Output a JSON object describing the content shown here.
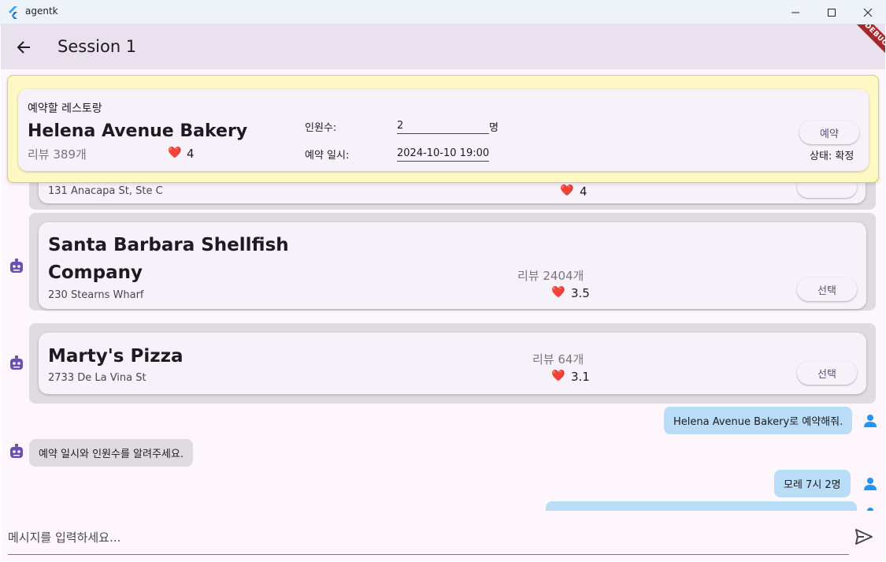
{
  "window": {
    "title": "agentk"
  },
  "appbar": {
    "title": "Session 1",
    "debug_label": "DEBUG"
  },
  "reservation": {
    "header": "예약할 레스토랑",
    "name": "Helena Avenue Bakery",
    "reviews": "리뷰 389개",
    "rating": "4",
    "party_label": "인원수:",
    "party_value": "2",
    "party_unit": "명",
    "datetime_label": "예약 일시:",
    "datetime_value": "2024-10-10 19:00",
    "reserve_button": "예약",
    "status": "상태: 확정"
  },
  "restaurants": [
    {
      "address": "131 Anacapa St, Ste C",
      "rating": "4"
    },
    {
      "name_line1": "Santa Barbara Shellfish",
      "name_line2": "Company",
      "address": "230 Stearns Wharf",
      "reviews": "리뷰 2404개",
      "rating": "3.5",
      "button": "선택"
    },
    {
      "name": "Marty's Pizza",
      "address": "2733 De La Vina St",
      "reviews": "리뷰 64개",
      "rating": "3.1",
      "button": "선택"
    }
  ],
  "messages": [
    {
      "role": "user",
      "text": "Helena Avenue Bakery로 예약해줘."
    },
    {
      "role": "bot",
      "text": "예약 일시와 인원수를 알려주세요."
    },
    {
      "role": "user",
      "text": "모레 7시 2명"
    }
  ],
  "input": {
    "placeholder": "메시지를 입력하세요..."
  },
  "colors": {
    "appbar": "#e9e1ed",
    "panel": "#fff8c5",
    "user_bubble": "#b9dcf7",
    "bot_bubble": "#dedcdf",
    "accent": "#6a4fb0"
  }
}
